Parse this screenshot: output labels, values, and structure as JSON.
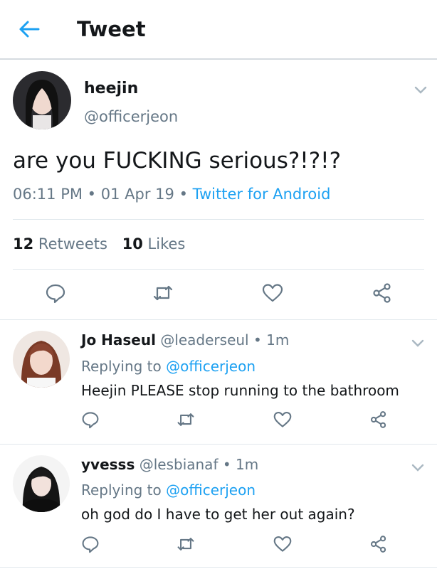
{
  "header": {
    "title": "Tweet"
  },
  "main_tweet": {
    "name": "heejin",
    "handle": "@officerjeon",
    "text": "are you FUCKING serious?!?!?",
    "time": "06:11 PM",
    "date": "01 Apr 19",
    "source": "Twitter for Android",
    "retweets_count": "12",
    "retweets_label": "Retweets",
    "likes_count": "10",
    "likes_label": "Likes"
  },
  "replies": [
    {
      "name": "Jo Haseul",
      "handle": "@leaderseul",
      "time": "1m",
      "replying_prefix": "Replying to",
      "replying_to": "@officerjeon",
      "text": "Heejin PLEASE stop running to the bathroom"
    },
    {
      "name": "yvesss",
      "handle": "@lesbianaf",
      "time": "1m",
      "replying_prefix": "Replying to",
      "replying_to": "@officerjeon",
      "text": "oh god do I have to get her out again?"
    }
  ],
  "separator": "•",
  "colors": {
    "accent": "#1da1f2",
    "muted": "#657786",
    "text": "#14171a",
    "divider": "#e1e8ed"
  },
  "icons": [
    "back-arrow-icon",
    "chevron-down-icon",
    "reply-icon",
    "retweet-icon",
    "like-icon",
    "share-icon"
  ]
}
